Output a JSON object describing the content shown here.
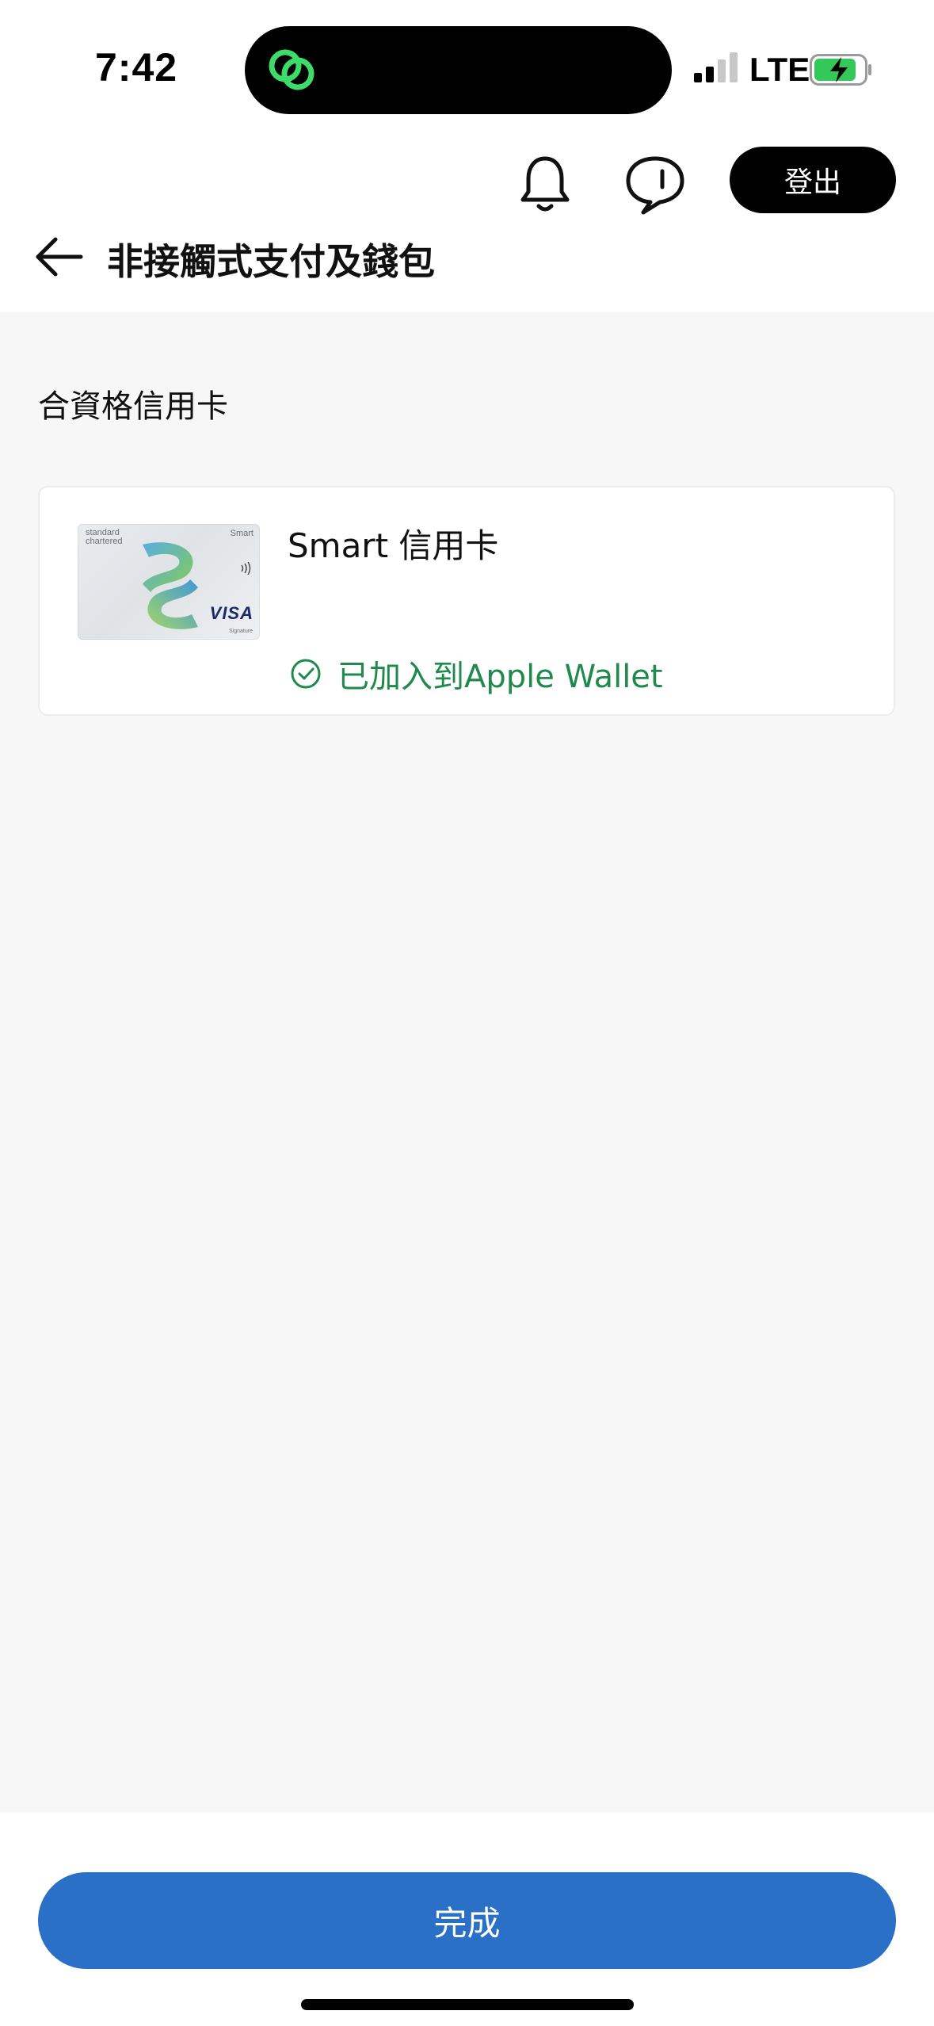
{
  "status_bar": {
    "time": "7:42",
    "network": "LTE",
    "icons": {
      "island_app": "linked-rings-icon",
      "signal": "cellular-signal-icon",
      "battery": "battery-charging-icon"
    },
    "colors": {
      "island_app": "#3ddc6a",
      "battery_fill": "#34c759"
    }
  },
  "header": {
    "logout_label": "登出",
    "page_title": "非接觸式支付及錢包",
    "icons": {
      "notifications": "bell-icon",
      "messages": "chat-bubble-icon",
      "back": "arrow-left-icon"
    }
  },
  "main": {
    "section_title": "合資格信用卡",
    "cards": [
      {
        "name": "Smart 信用卡",
        "wallet_status": "已加入到Apple Wallet",
        "status_icon": "check-circle-icon",
        "image": {
          "brand": "standard chartered",
          "variant": "Smart",
          "network": "VISA",
          "tier": "Signature"
        }
      }
    ]
  },
  "footer": {
    "done_label": "完成"
  },
  "colors": {
    "primary_button": "#2970c6",
    "success": "#1f8a4c",
    "background": "#f7f7f7"
  }
}
